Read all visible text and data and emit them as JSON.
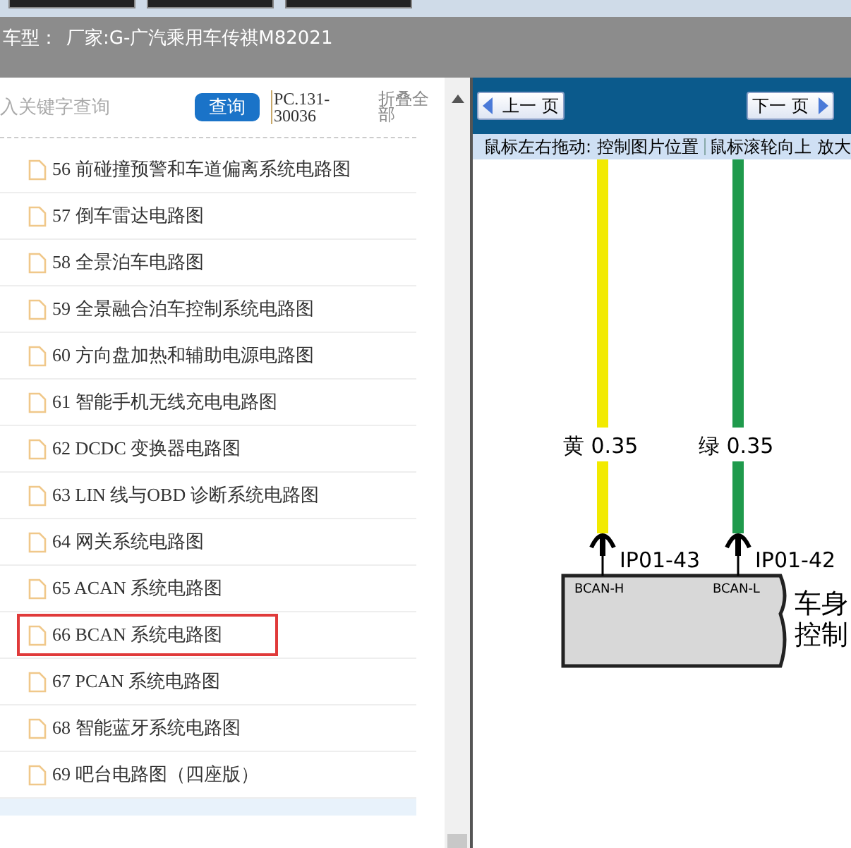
{
  "header": {
    "label": "车型：",
    "value": "厂家:G-广汽乘用车传祺M82021"
  },
  "search": {
    "placeholder": "入关键字查询",
    "button": "查询",
    "code": "PC.131-30036",
    "collapse": "折叠全部"
  },
  "items": [
    {
      "label": "56 前碰撞预警和车道偏离系统电路图",
      "selected": false
    },
    {
      "label": "57 倒车雷达电路图",
      "selected": false
    },
    {
      "label": "58 全景泊车电路图",
      "selected": false
    },
    {
      "label": "59 全景融合泊车控制系统电路图",
      "selected": false
    },
    {
      "label": "60 方向盘加热和辅助电源电路图",
      "selected": false
    },
    {
      "label": "61 智能手机无线充电电路图",
      "selected": false
    },
    {
      "label": "62 DCDC 变换器电路图",
      "selected": false
    },
    {
      "label": "63 LIN 线与OBD 诊断系统电路图",
      "selected": false
    },
    {
      "label": "64 网关系统电路图",
      "selected": false
    },
    {
      "label": "65 ACAN 系统电路图",
      "selected": false
    },
    {
      "label": "66 BCAN 系统电路图",
      "selected": true
    },
    {
      "label": "67 PCAN 系统电路图",
      "selected": false
    },
    {
      "label": "68 智能蓝牙系统电路图",
      "selected": false
    },
    {
      "label": "69 吧台电路图（四座版）",
      "selected": false
    }
  ],
  "viewer": {
    "prev": "上一 页",
    "next": "下一 页",
    "hints": [
      "鼠标左右拖动: 控制图片位置",
      "鼠标滚轮向上 放大"
    ],
    "wires": [
      {
        "name": "黄",
        "gauge": "0.35",
        "pin": "IP01-43",
        "signal": "BCAN-H",
        "color": "#f2ea00"
      },
      {
        "name": "绿",
        "gauge": "0.35",
        "pin": "IP01-42",
        "signal": "BCAN-L",
        "color": "#1f9a4c"
      }
    ],
    "module_lines": [
      "车身",
      "控制"
    ]
  }
}
